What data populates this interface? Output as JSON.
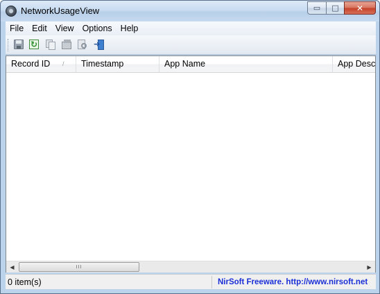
{
  "window": {
    "title": "NetworkUsageView",
    "minimize_glyph": "▭",
    "maximize_glyph": "□",
    "close_glyph": "✕"
  },
  "menu": {
    "items": [
      "File",
      "Edit",
      "View",
      "Options",
      "Help"
    ]
  },
  "toolbar": {
    "icons": [
      "save-icon",
      "refresh-icon",
      "copy-icon",
      "properties-icon",
      "find-icon",
      "exit-icon"
    ]
  },
  "list": {
    "columns": [
      "Record ID",
      "Timestamp",
      "App Name",
      "App Desc"
    ],
    "sort_indicator": "/",
    "rows": []
  },
  "scrollbar": {
    "left_arrow": "◀",
    "right_arrow": "▶",
    "thumb_grip": "III"
  },
  "status": {
    "item_count": "0 item(s)",
    "credit": "NirSoft Freeware.  http://www.nirsoft.net"
  },
  "colors": {
    "credit_link": "#1a2fd6",
    "close_button": "#c4432a"
  }
}
